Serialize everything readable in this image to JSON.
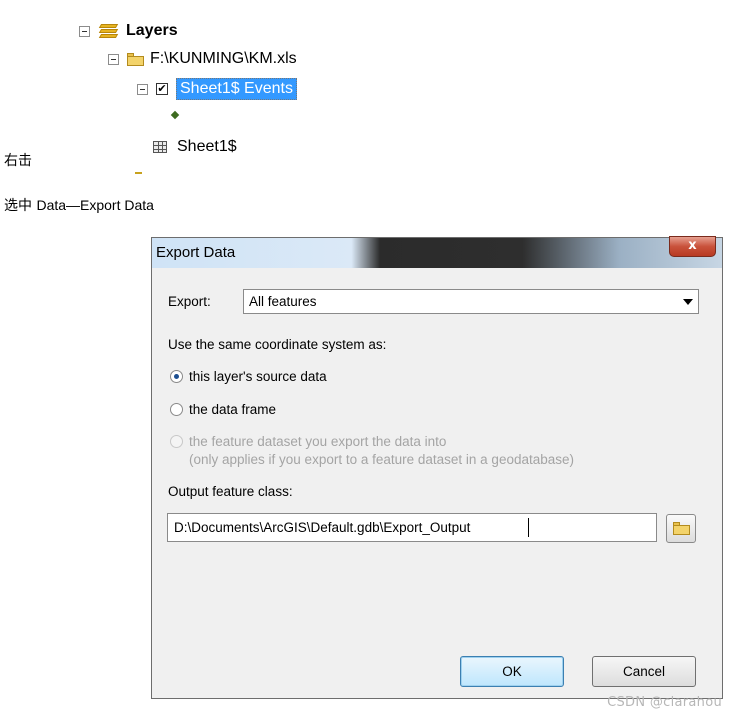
{
  "tree": {
    "root_label": "Layers",
    "workbook_label": "F:\\KUNMING\\KM.xls",
    "events_layer_label": "Sheet1$ Events",
    "events_layer_checked": "✔",
    "table_label": "Sheet1$"
  },
  "notes": {
    "right_click": "右击",
    "select_prefix": "选中 ",
    "select_path": "Data—Export Data"
  },
  "dialog": {
    "title": "Export Data",
    "close_glyph": "x",
    "export_label": "Export:",
    "export_value": "All features",
    "coord_label": "Use the same coordinate system as:",
    "options": [
      {
        "label": "this layer's source data",
        "checked": true,
        "enabled": true
      },
      {
        "label": "the data frame",
        "checked": false,
        "enabled": true
      },
      {
        "label": "the feature dataset you export the data into",
        "sub": "(only applies if you export to a feature dataset in a geodatabase)",
        "checked": false,
        "enabled": false
      }
    ],
    "output_label": "Output feature class:",
    "output_value": "D:\\Documents\\ArcGIS\\Default.gdb\\Export_Output",
    "ok_label": "OK",
    "cancel_label": "Cancel"
  },
  "watermark": "CSDN @clarahou",
  "colors": {
    "selection": "#3399ff",
    "dialog_bg": "#f0f0f0",
    "close_button": "#c9523b"
  }
}
